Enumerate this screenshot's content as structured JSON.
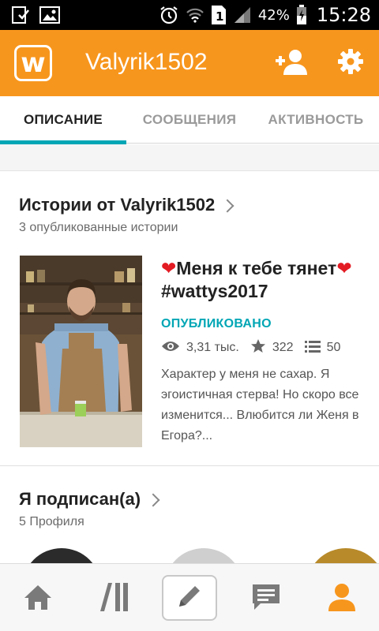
{
  "status_bar": {
    "battery": "42%",
    "time": "15:28"
  },
  "app_bar": {
    "logo_letter": "w",
    "username": "Valyrik1502"
  },
  "tabs": [
    {
      "label": "ОПИСАНИЕ"
    },
    {
      "label": "СООБЩЕНИЯ"
    },
    {
      "label": "АКТИВНОСТЬ"
    }
  ],
  "stories": {
    "title": "Истории от Valyrik1502",
    "subtitle": "3 опубликованные истории",
    "item": {
      "title_part1": "Меня к тебе тянет",
      "title_part2": "#wattys2017",
      "status": "ОПУБЛИКОВАНО",
      "reads": "3,31 тыс.",
      "votes": "322",
      "parts": "50",
      "description": "Характер у меня не сахар. Я эгоистичная стерва! Но скоро все изменится... Влюбится ли Женя в Егора?..."
    }
  },
  "following": {
    "title": "Я подписан(а)",
    "subtitle": "5 Профиля"
  },
  "colors": {
    "accent": "#f7961d",
    "teal": "#00a6b5",
    "heart": "#e31b23"
  },
  "nav": [
    "home-icon",
    "library-icon",
    "write-icon",
    "messages-icon",
    "profile-icon"
  ]
}
